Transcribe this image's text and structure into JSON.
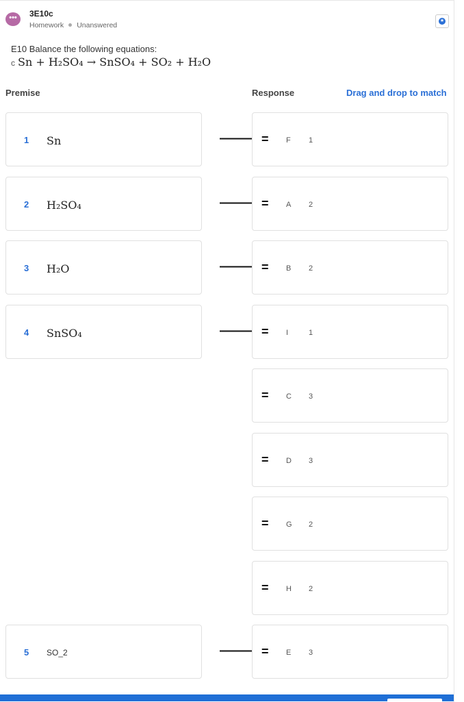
{
  "header": {
    "title": "3E10c",
    "category": "Homework",
    "status": "Unanswered",
    "chat_icon_glyph": "•••"
  },
  "question": {
    "text": "E10 Balance the following equations:",
    "label": "c",
    "equation": "Sn + H₂SO₄ → SnSO₄ + SO₂ + H₂O"
  },
  "columns": {
    "premise": "Premise",
    "response": "Response",
    "instruction": "Drag and drop to match"
  },
  "premises": [
    {
      "num": "1",
      "text": "Sn"
    },
    {
      "num": "2",
      "text": "H₂SO₄"
    },
    {
      "num": "3",
      "text": "H₂O"
    },
    {
      "num": "4",
      "text": "SnSO₄"
    },
    {
      "num": "5",
      "text": "SO_2"
    }
  ],
  "responses": [
    {
      "letter": "F",
      "count": "1"
    },
    {
      "letter": "A",
      "count": "2"
    },
    {
      "letter": "B",
      "count": "2"
    },
    {
      "letter": "I",
      "count": "1"
    },
    {
      "letter": "C",
      "count": "3"
    },
    {
      "letter": "D",
      "count": "3"
    },
    {
      "letter": "G",
      "count": "2"
    },
    {
      "letter": "H",
      "count": "2"
    },
    {
      "letter": "E",
      "count": "3"
    }
  ],
  "glyphs": {
    "arrow": "🡒",
    "grip": "=",
    "fav": "★"
  },
  "colors": {
    "accent": "#2a6fd6",
    "chat_icon": "#b66aa5",
    "bottom_bar": "#1f6fd6"
  }
}
